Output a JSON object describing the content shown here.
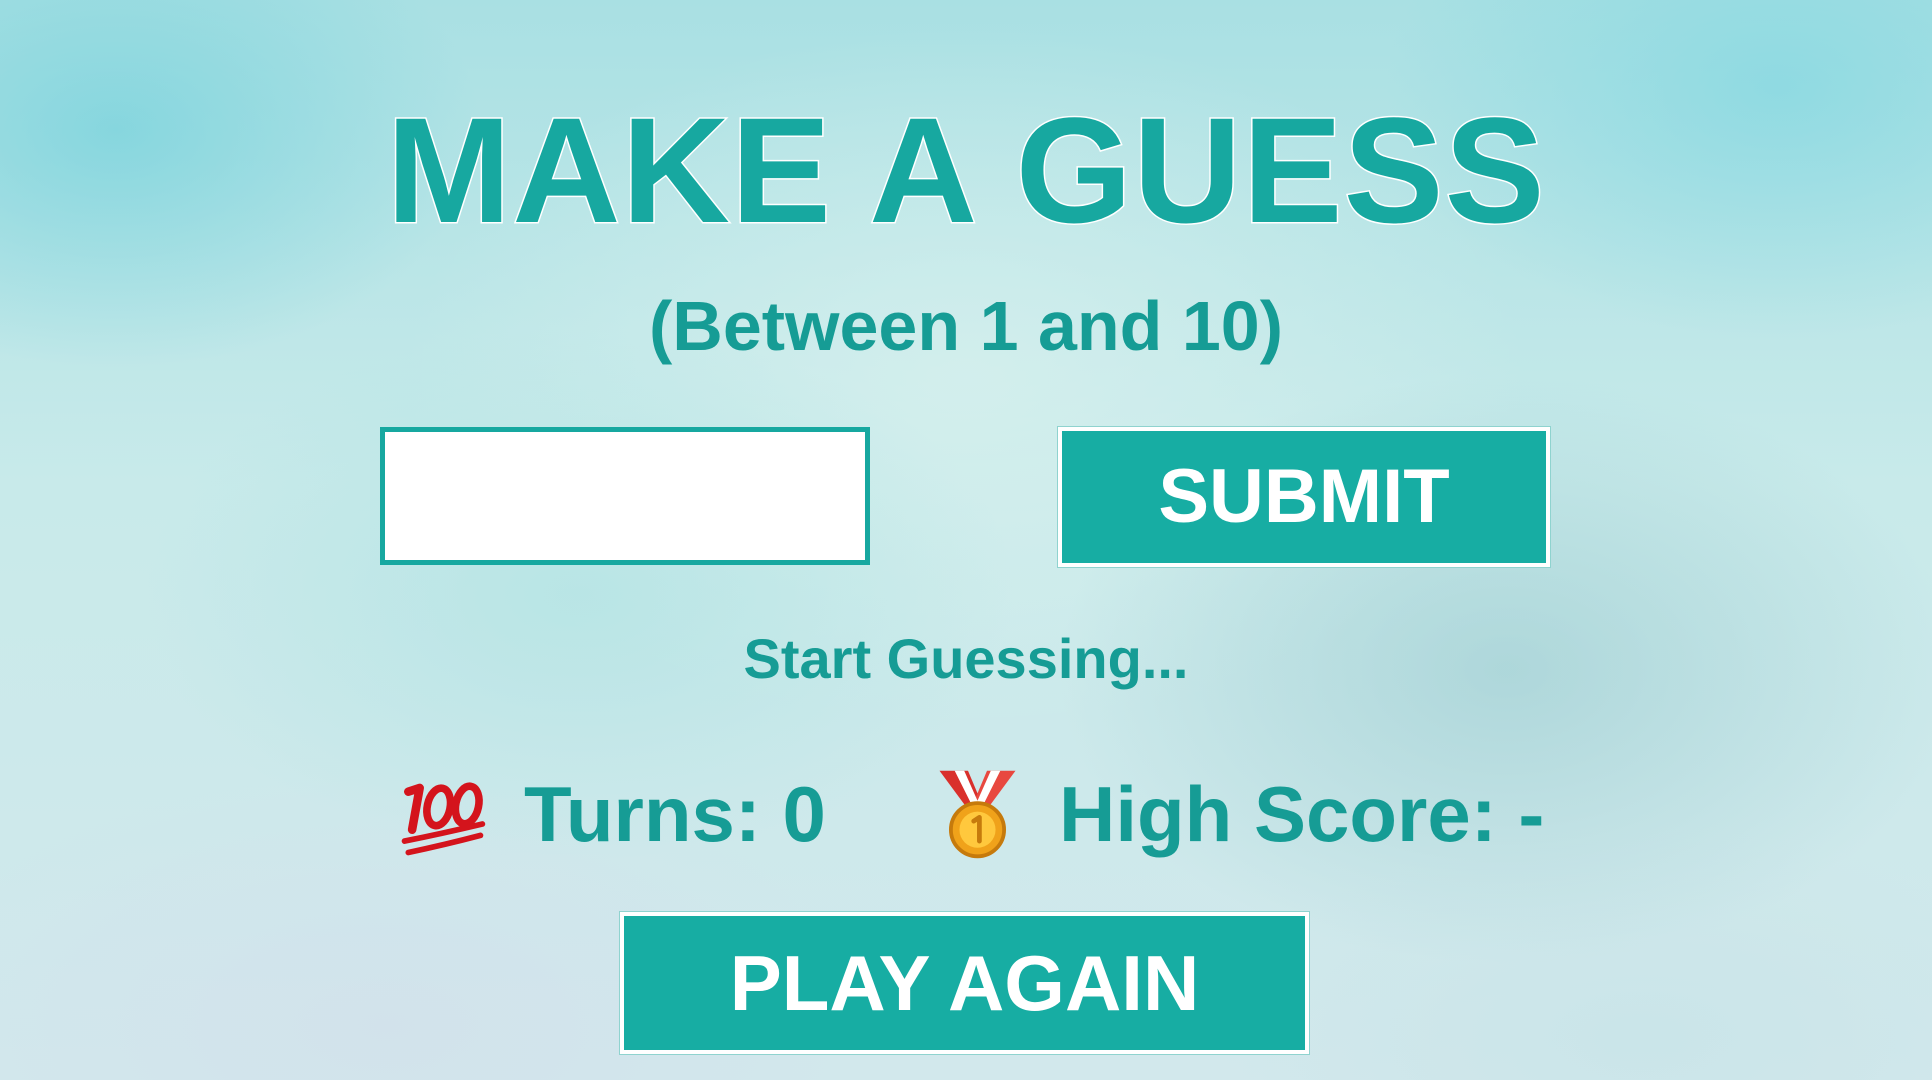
{
  "game": {
    "title": "MAKE A GUESS",
    "subtitle": "(Between 1 and 10)",
    "guess_input": {
      "value": "",
      "placeholder": ""
    },
    "submit_label": "SUBMIT",
    "message": "Start Guessing...",
    "turns": {
      "icon": "hundred-points-icon",
      "label": "Turns: 0"
    },
    "high_score": {
      "icon": "first-place-medal-icon",
      "label": "High Score: -"
    },
    "play_again_label": "PLAY AGAIN"
  },
  "colors": {
    "accent": "#17a8a0",
    "button": "#17ada3",
    "button_text": "#ffffff"
  }
}
